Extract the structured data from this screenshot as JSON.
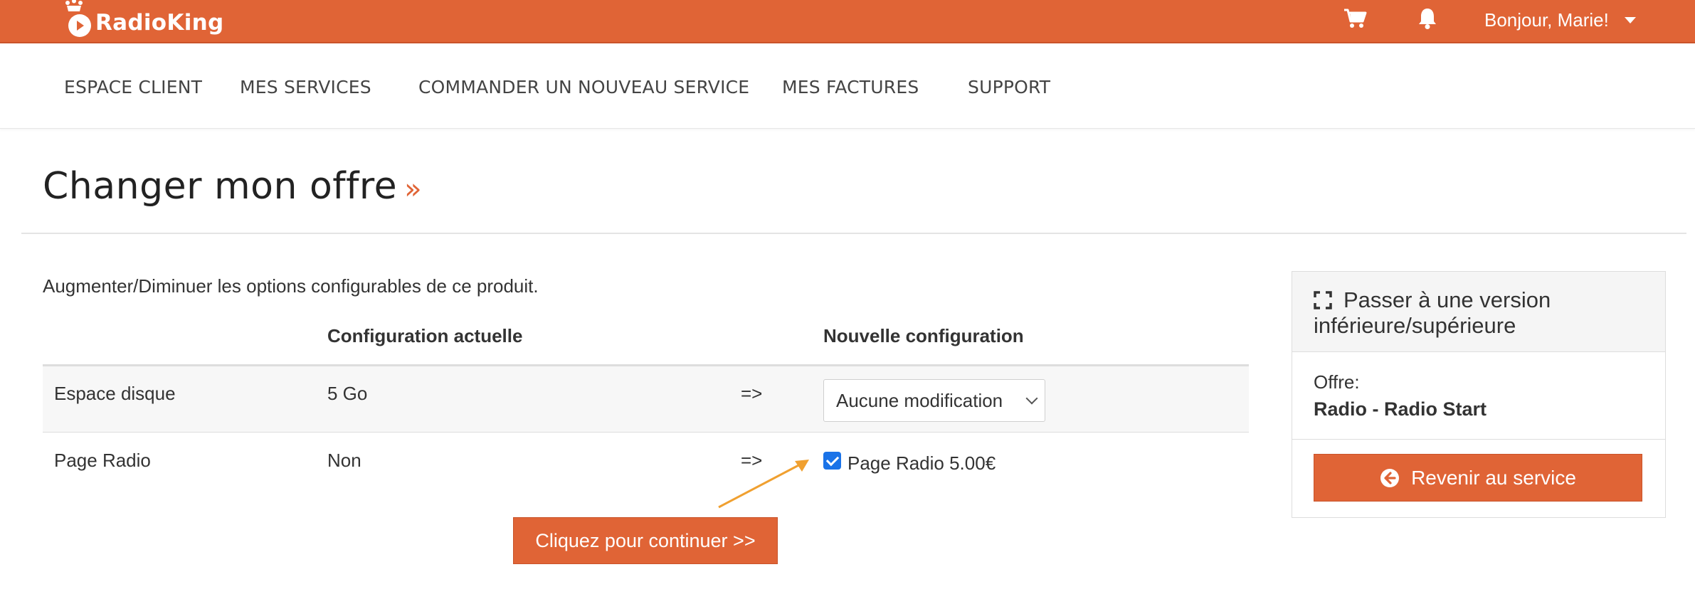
{
  "brand": {
    "name": "RadioKing",
    "accent_color": "#e06436"
  },
  "topbar": {
    "cart_icon": "cart-icon",
    "bell_icon": "bell-icon",
    "greeting": "Bonjour, Marie!"
  },
  "nav": {
    "items": [
      {
        "label": "ESPACE CLIENT"
      },
      {
        "label": "MES SERVICES"
      },
      {
        "label": "COMMANDER UN NOUVEAU SERVICE"
      },
      {
        "label": "MES FACTURES"
      },
      {
        "label": "SUPPORT"
      }
    ]
  },
  "page": {
    "title": "Changer mon offre",
    "title_suffix": "»",
    "intro": "Augmenter/Diminuer les options configurables de ce produit."
  },
  "table": {
    "headers": {
      "current": "Configuration actuelle",
      "new": "Nouvelle configuration"
    },
    "rows": [
      {
        "label": "Espace disque",
        "current": "5 Go",
        "arrow": "=>",
        "new_value": "Aucune modification"
      },
      {
        "label": "Page Radio",
        "current": "Non",
        "arrow": "=>",
        "new_value": "Page Radio 5.00€",
        "checked": true
      }
    ]
  },
  "actions": {
    "continue_label": "Cliquez pour continuer >>"
  },
  "panel": {
    "title": "Passer à une version inférieure/supérieure",
    "offer_label": "Offre:",
    "offer_value": "Radio - Radio Start",
    "back_label": "Revenir au service"
  }
}
